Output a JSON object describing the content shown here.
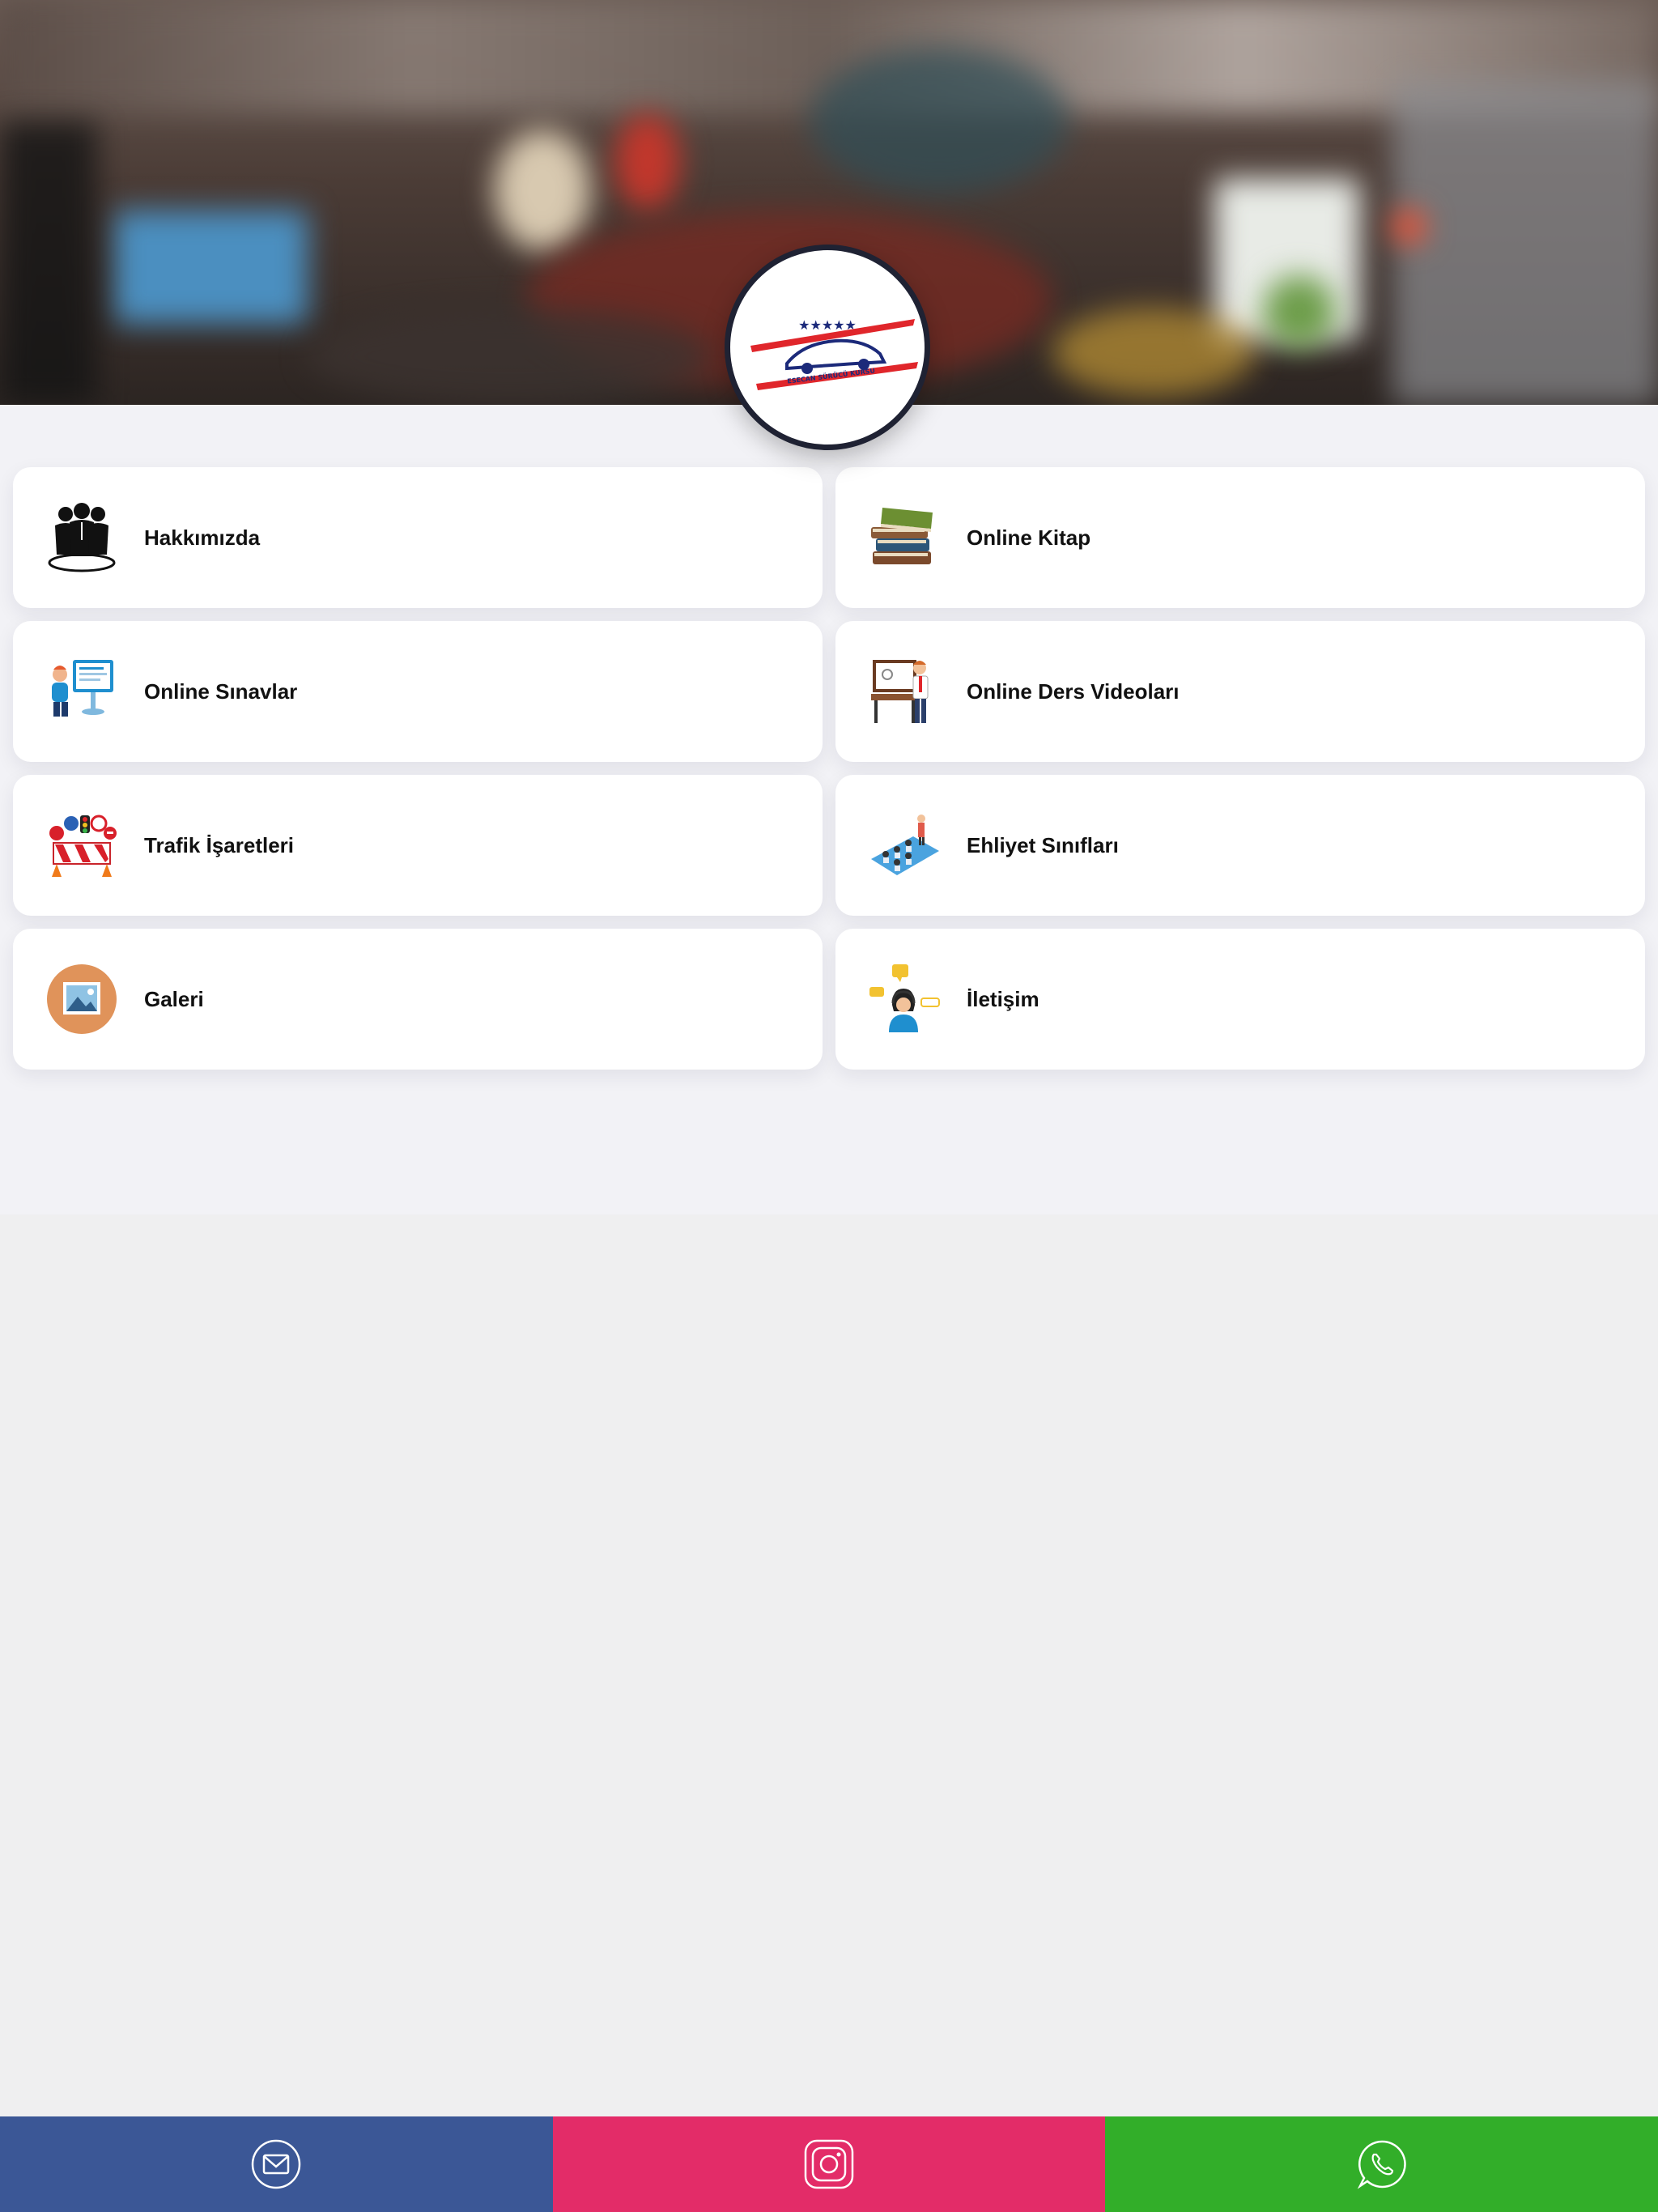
{
  "logo": {
    "alt": "logo-image",
    "text": "ESECAN SÜRÜCÜ KURSU"
  },
  "menu": [
    {
      "label": "Hakkımızda",
      "icon": "business-people-icon"
    },
    {
      "label": "Online Kitap",
      "icon": "books-stack-icon"
    },
    {
      "label": "Online Sınavlar",
      "icon": "computer-exam-icon"
    },
    {
      "label": "Online Ders Videoları",
      "icon": "teacher-whiteboard-icon"
    },
    {
      "label": "Trafik İşaretleri",
      "icon": "traffic-signs-icon"
    },
    {
      "label": "Ehliyet Sınıfları",
      "icon": "classroom-icon"
    },
    {
      "label": "Galeri",
      "icon": "image-gallery-icon"
    },
    {
      "label": "İletişim",
      "icon": "contact-support-icon"
    }
  ],
  "bottom_bar": {
    "mail_icon": "envelope-icon",
    "instagram_icon": "instagram-icon",
    "whatsapp_icon": "whatsapp-icon",
    "colors": {
      "mail": "#3b5796",
      "instagram": "#e32c68",
      "whatsapp": "#32ae29"
    }
  }
}
